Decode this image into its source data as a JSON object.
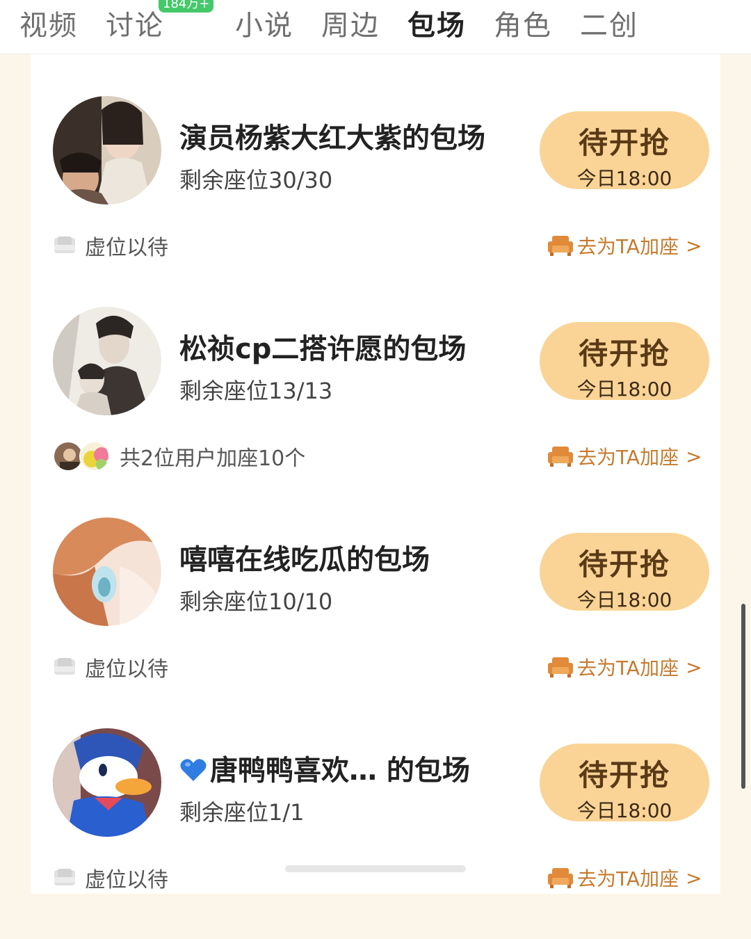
{
  "tabs": [
    {
      "label": "视频"
    },
    {
      "label": "讨论",
      "badge": "184万+"
    },
    {
      "label": "小说"
    },
    {
      "label": "周边"
    },
    {
      "label": "包场",
      "active": true
    },
    {
      "label": "角色"
    },
    {
      "label": "二创"
    }
  ],
  "items": [
    {
      "title": "演员杨紫大红大紫的包场",
      "seats": "剩余座位30/30",
      "button_main": "待开抢",
      "button_time": "今日18:00",
      "footer_left": "虚位以待",
      "footer_right": "去为TA加座"
    },
    {
      "title": "松祯cp二搭许愿的包场",
      "seats": "剩余座位13/13",
      "button_main": "待开抢",
      "button_time": "今日18:00",
      "footer_left": "共2位用户加座10个",
      "footer_right": "去为TA加座"
    },
    {
      "title": "嘻嘻在线吃瓜的包场",
      "seats": "剩余座位10/10",
      "button_main": "待开抢",
      "button_time": "今日18:00",
      "footer_left": "虚位以待",
      "footer_right": "去为TA加座"
    },
    {
      "title": "唐鸭鸭喜欢…  的包场",
      "title_icon": "blue-heart-icon",
      "seats": "剩余座位1/1",
      "button_main": "待开抢",
      "button_time": "今日18:00",
      "footer_left": "虚位以待",
      "footer_right": "去为TA加座"
    }
  ],
  "chevron": ">",
  "colors": {
    "accent": "#c67a2e",
    "button_bg": "#fad496",
    "badge_bg": "#45c86a",
    "page_bg": "#fbf6e9"
  }
}
